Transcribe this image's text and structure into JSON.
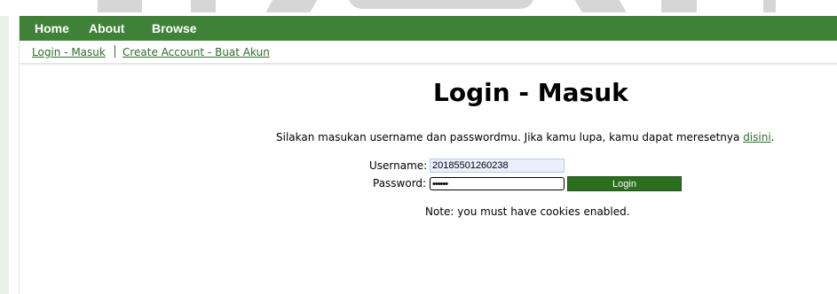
{
  "nav": {
    "items": [
      {
        "label": "Home"
      },
      {
        "label": "About"
      },
      {
        "label": "Browse"
      }
    ]
  },
  "subnav": {
    "login_link": "Login - Masuk",
    "create_account_link": "Create Account - Buat Akun"
  },
  "main": {
    "title": "Login - Masuk",
    "intro_text": "Silakan masukan username dan passwordmu. Jika kamu lupa, kamu dapat meresetnya ",
    "intro_link": "disini",
    "intro_end": ".",
    "note": "Note: you must have cookies enabled."
  },
  "form": {
    "username_label": "Username:",
    "username_value": "20185501260238",
    "password_label": "Password:",
    "password_value": "••••••",
    "login_button": "Login"
  },
  "colors": {
    "nav_background": "#3f8237",
    "link": "#2c6e28",
    "login_button": "#2b6e1f",
    "username_autofill": "#e8f0fe"
  }
}
